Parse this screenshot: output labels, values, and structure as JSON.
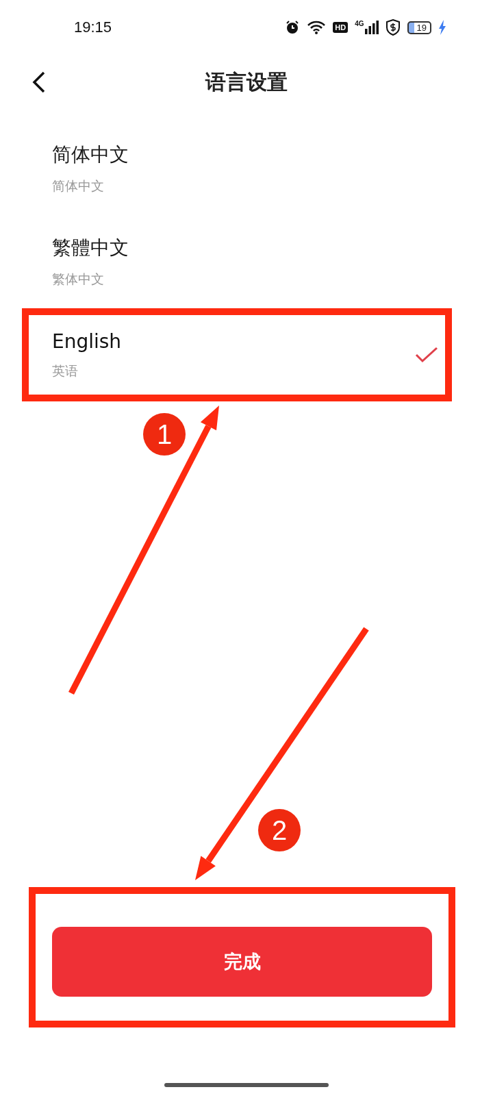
{
  "status_bar": {
    "time": "19:15",
    "network": "4G",
    "hd_badge": "HD",
    "battery": "19"
  },
  "header": {
    "title": "语言设置"
  },
  "languages": [
    {
      "name": "简体中文",
      "subtitle": "简体中文",
      "selected": false,
      "highlighted": false
    },
    {
      "name": "繁體中文",
      "subtitle": "繁体中文",
      "selected": false,
      "highlighted": false
    },
    {
      "name": "English",
      "subtitle": "英语",
      "selected": true,
      "highlighted": true
    }
  ],
  "done_button": {
    "label": "完成",
    "highlighted": true
  },
  "annotations": [
    {
      "label": "1"
    },
    {
      "label": "2"
    }
  ]
}
